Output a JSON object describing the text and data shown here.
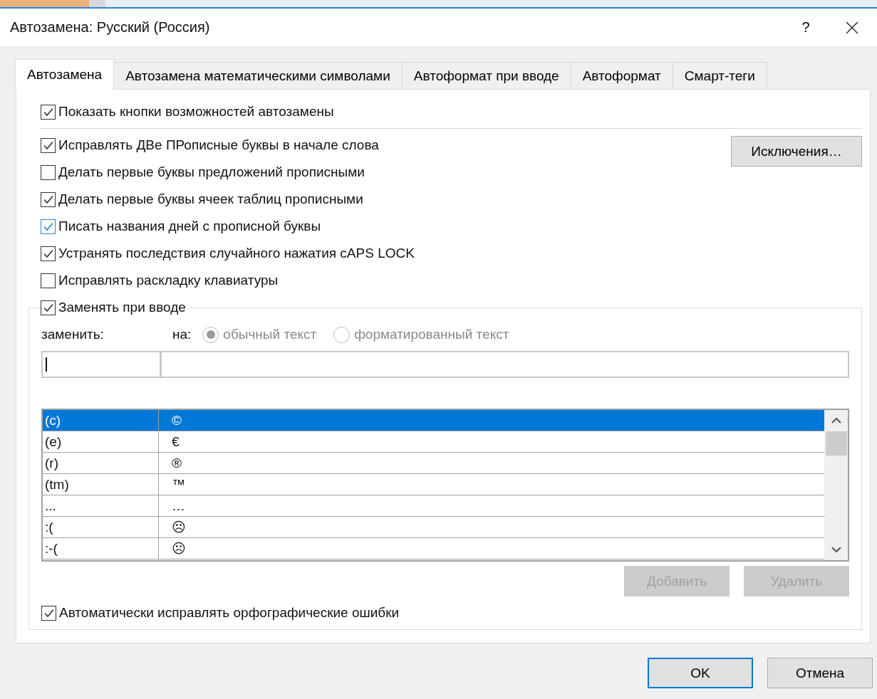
{
  "window": {
    "title": "Автозамена: Русский (Россия)",
    "help": "?"
  },
  "tabs": [
    {
      "label": "Автозамена",
      "selected": true
    },
    {
      "label": "Автозамена математическими символами",
      "selected": false
    },
    {
      "label": "Автоформат при вводе",
      "selected": false
    },
    {
      "label": "Автоформат",
      "selected": false
    },
    {
      "label": "Смарт-теги",
      "selected": false
    }
  ],
  "show_buttons_option": {
    "label": "Показать кнопки возможностей автозамены",
    "checked": true,
    "focused": false
  },
  "options": [
    {
      "label": "Исправлять ДВе ПРописные буквы в начале слова",
      "checked": true,
      "focused": false
    },
    {
      "label": "Делать первые буквы предложений прописными",
      "checked": false,
      "focused": false
    },
    {
      "label": "Делать первые буквы ячеек таблиц прописными",
      "checked": true,
      "focused": false
    },
    {
      "label": "Писать названия дней с прописной буквы",
      "checked": true,
      "focused": true
    },
    {
      "label": "Устранять последствия случайного нажатия cAPS LOCK",
      "checked": true,
      "focused": false
    },
    {
      "label": "Исправлять раскладку клавиатуры",
      "checked": false,
      "focused": false
    }
  ],
  "exceptions_button": "Исключения…",
  "replace_group": {
    "option": {
      "label": "Заменять при вводе",
      "checked": true,
      "focused": false
    },
    "replace_label": "заменить:",
    "with_label": "на:",
    "format_options": [
      {
        "label": "обычный текст",
        "selected": true,
        "disabled": true
      },
      {
        "label": "форматированный текст",
        "selected": false,
        "disabled": true
      }
    ],
    "entries": [
      {
        "replace": "(c)",
        "with": "©",
        "selected": true
      },
      {
        "replace": "(e)",
        "with": "€",
        "selected": false
      },
      {
        "replace": "(r)",
        "with": "®",
        "selected": false
      },
      {
        "replace": "(tm)",
        "with": "™",
        "selected": false
      },
      {
        "replace": "...",
        "with": "…",
        "selected": false
      },
      {
        "replace": ":(",
        "with": "☹",
        "selected": false
      },
      {
        "replace": ":-(",
        "with": "☹",
        "selected": false
      }
    ],
    "buttons": [
      {
        "label": "Добавить",
        "disabled": true
      },
      {
        "label": "Удалить",
        "disabled": true
      }
    ],
    "spelling_option": {
      "label": "Автоматически исправлять орфографические ошибки",
      "checked": true,
      "focused": false
    }
  },
  "dialog_buttons": [
    {
      "label": "OK",
      "default": true
    },
    {
      "label": "Отмена",
      "default": false
    }
  ]
}
